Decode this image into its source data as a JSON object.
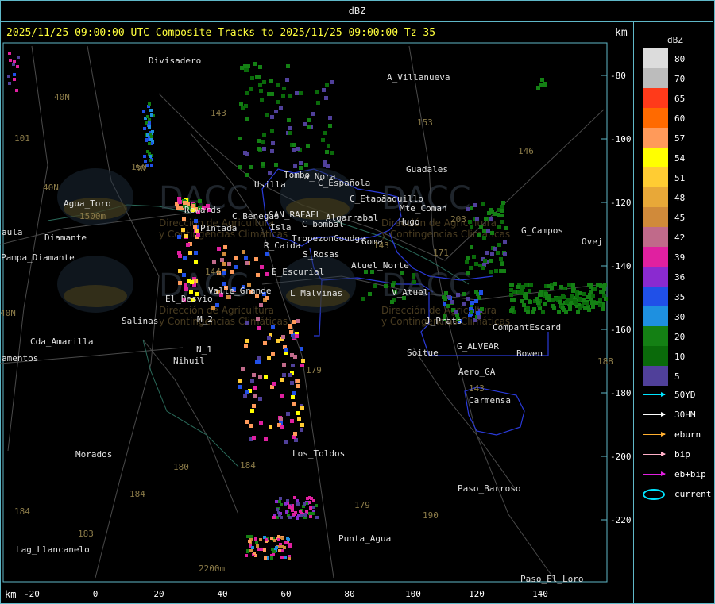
{
  "window": {
    "title": "dBZ"
  },
  "header": {
    "text": "2025/11/25 09:00:00 UTC Composite Tracks to 2025/11/25 09:00:00 Tz 35",
    "unit_top": "km",
    "unit_bottom": "km"
  },
  "axes": {
    "x_ticks": [
      "-20",
      "0",
      "20",
      "40",
      "60",
      "80",
      "100",
      "120",
      "140"
    ],
    "y_ticks": [
      "-80",
      "-100",
      "-120",
      "-140",
      "-160",
      "-180",
      "-200",
      "-220"
    ]
  },
  "legend": {
    "title": "dBZ",
    "levels": [
      {
        "value": "80",
        "color": "#dcdcdc"
      },
      {
        "value": "70",
        "color": "#bcbcbc"
      },
      {
        "value": "65",
        "color": "#ff3a1a"
      },
      {
        "value": "60",
        "color": "#ff6a00"
      },
      {
        "value": "57",
        "color": "#ff9a5a"
      },
      {
        "value": "54",
        "color": "#ffff00"
      },
      {
        "value": "51",
        "color": "#ffcc33"
      },
      {
        "value": "48",
        "color": "#e8a838"
      },
      {
        "value": "45",
        "color": "#d08a3a"
      },
      {
        "value": "42",
        "color": "#c06a8a"
      },
      {
        "value": "39",
        "color": "#e020a0"
      },
      {
        "value": "36",
        "color": "#8a2ad0"
      },
      {
        "value": "35",
        "color": "#2050e8"
      },
      {
        "value": "30",
        "color": "#1e90e0"
      },
      {
        "value": "20",
        "color": "#148014"
      },
      {
        "value": "10",
        "color": "#0a6a0a"
      },
      {
        "value": "5",
        "color": "#50409a"
      }
    ]
  },
  "tracks": [
    {
      "label": "50YD",
      "color": "#00e5ff"
    },
    {
      "label": "30HM",
      "color": "#ffffff"
    },
    {
      "label": "eburn",
      "color": "#ffb030"
    },
    {
      "label": "bip",
      "color": "#ffb0c8"
    },
    {
      "label": "eb+bip",
      "color": "#e020e0"
    }
  ],
  "current_label": "current",
  "places": [
    "Divisadero",
    "A_Villanueva",
    "Guadales",
    "La_Nora",
    "C_Española",
    "Usilla",
    "Tombo",
    "C_Etapa",
    "Jaquillo",
    "Mte_Coman",
    "SAN_RAFAEL",
    "C_Benegas",
    "Algarrabal",
    "C_bombal",
    "Isla",
    "Tropezon",
    "Goudge",
    "R_Caida",
    "S_Rosas",
    "Atuel_Norte",
    "E_Escurial",
    "L_Malvinas",
    "Valle_Grande",
    "V_Atuel",
    "Pintada",
    "Rewards",
    "El_Desvio",
    "Salinas",
    "M_2",
    "N_1",
    "Nihuil",
    "Agua_Toro",
    "Pampa_Diamante",
    "Diamante",
    "aula",
    "Cda_Amarilla",
    "amentos",
    "Morados",
    "Los_Toldos",
    "Soitue",
    "G_ALVEAR",
    "Bowen",
    "CompantEscard",
    "J_Prats",
    "Aero_GA",
    "Carmensa",
    "Paso_Barroso",
    "Punta_Agua",
    "Lag_Llancanelo",
    "Paso_El_Loro",
    "G_Campos",
    "Ovej",
    "Hugo",
    "Goma"
  ],
  "road_numbers": [
    "101",
    "143",
    "153",
    "146",
    "143",
    "203",
    "171",
    "144",
    "179",
    "180",
    "184",
    "183",
    "184",
    "179",
    "190",
    "184",
    "143",
    "188",
    "150"
  ],
  "watermark": {
    "brand": "DACC",
    "line1": "Dirección de Agricultura",
    "line2": "y Contingencias Climáticas"
  },
  "annotations": [
    "40N",
    "40N",
    "40N",
    "50",
    "2200m",
    "1500m"
  ]
}
